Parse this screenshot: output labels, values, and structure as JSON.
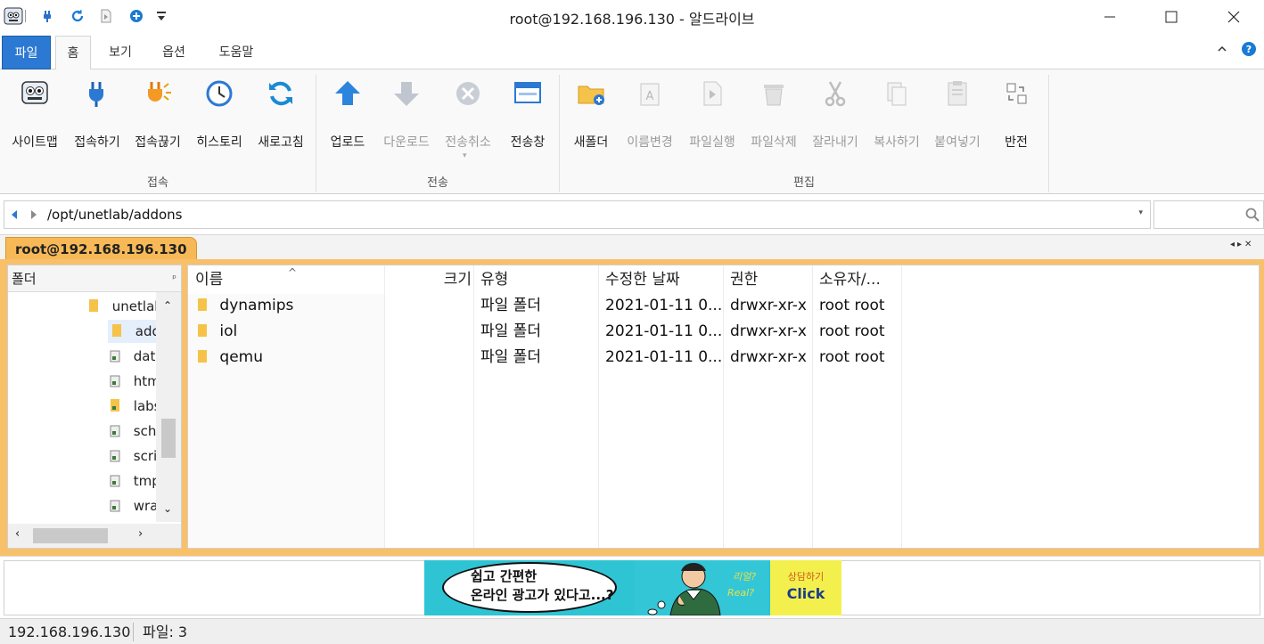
{
  "window": {
    "title": "root@192.168.196.130 - 알드라이브"
  },
  "ribbon_tabs": [
    {
      "label": "파일"
    },
    {
      "label": "홈"
    },
    {
      "label": "보기"
    },
    {
      "label": "옵션"
    },
    {
      "label": "도움말"
    }
  ],
  "ribbon": {
    "connect_group": {
      "label": "접속",
      "buttons": [
        {
          "label": "사이트맵",
          "icon": "sitemap-icon"
        },
        {
          "label": "접속하기",
          "icon": "connect-plug-icon"
        },
        {
          "label": "접속끊기",
          "icon": "disconnect-plug-icon"
        },
        {
          "label": "히스토리",
          "icon": "clock-icon"
        },
        {
          "label": "새로고침",
          "icon": "refresh-icon"
        }
      ]
    },
    "transfer_group": {
      "label": "전송",
      "buttons": [
        {
          "label": "업로드",
          "icon": "upload-arrow-icon"
        },
        {
          "label": "다운로드",
          "icon": "download-arrow-icon"
        },
        {
          "label": "전송취소",
          "icon": "cancel-x-icon"
        },
        {
          "label": "전송창",
          "icon": "transfer-window-icon"
        }
      ]
    },
    "edit_group": {
      "label": "편집",
      "buttons": [
        {
          "label": "새폴더",
          "icon": "new-folder-icon"
        },
        {
          "label": "이름변경",
          "icon": "rename-icon"
        },
        {
          "label": "파일실행",
          "icon": "run-file-icon"
        },
        {
          "label": "파일삭제",
          "icon": "trash-icon"
        },
        {
          "label": "잘라내기",
          "icon": "scissors-icon"
        },
        {
          "label": "복사하기",
          "icon": "copy-icon"
        },
        {
          "label": "붙여넣기",
          "icon": "paste-icon"
        },
        {
          "label": "반전",
          "icon": "invert-selection-icon"
        }
      ]
    }
  },
  "address": {
    "path": "/opt/unetlab/addons"
  },
  "session_tab": {
    "label": "root@192.168.196.130"
  },
  "folder_tree": {
    "header": "폴더",
    "items": [
      {
        "label": "unetlab",
        "type": "folder"
      },
      {
        "label": "addons",
        "type": "folder"
      },
      {
        "label": "data",
        "type": "link"
      },
      {
        "label": "html",
        "type": "link"
      },
      {
        "label": "labs",
        "type": "folder"
      },
      {
        "label": "scheduler",
        "type": "link"
      },
      {
        "label": "scripts",
        "type": "link"
      },
      {
        "label": "tmp",
        "type": "link"
      },
      {
        "label": "wrappers",
        "type": "link"
      }
    ]
  },
  "file_list": {
    "columns": [
      "이름",
      "크기",
      "유형",
      "수정한 날짜",
      "권한",
      "소유자/..."
    ],
    "rows": [
      {
        "name": "dynamips",
        "size": "",
        "type": "파일 폴더",
        "modified": "2021-01-11 0...",
        "perm": "drwxr-xr-x",
        "owner": "root root"
      },
      {
        "name": "iol",
        "size": "",
        "type": "파일 폴더",
        "modified": "2021-01-11 0...",
        "perm": "drwxr-xr-x",
        "owner": "root root"
      },
      {
        "name": "qemu",
        "size": "",
        "type": "파일 폴더",
        "modified": "2021-01-11 0...",
        "perm": "drwxr-xr-x",
        "owner": "root root"
      }
    ]
  },
  "ad": {
    "line1": "쉽고 간편한",
    "line2": "온라인 광고가 있다고...?",
    "small": "상담하기",
    "click": "Click"
  },
  "status": {
    "host": "192.168.196.130",
    "files": "파일: 3"
  },
  "colors": {
    "accent_blue": "#2b79d3",
    "session_orange": "#f7b958",
    "folder_yellow": "#f5c34a"
  }
}
